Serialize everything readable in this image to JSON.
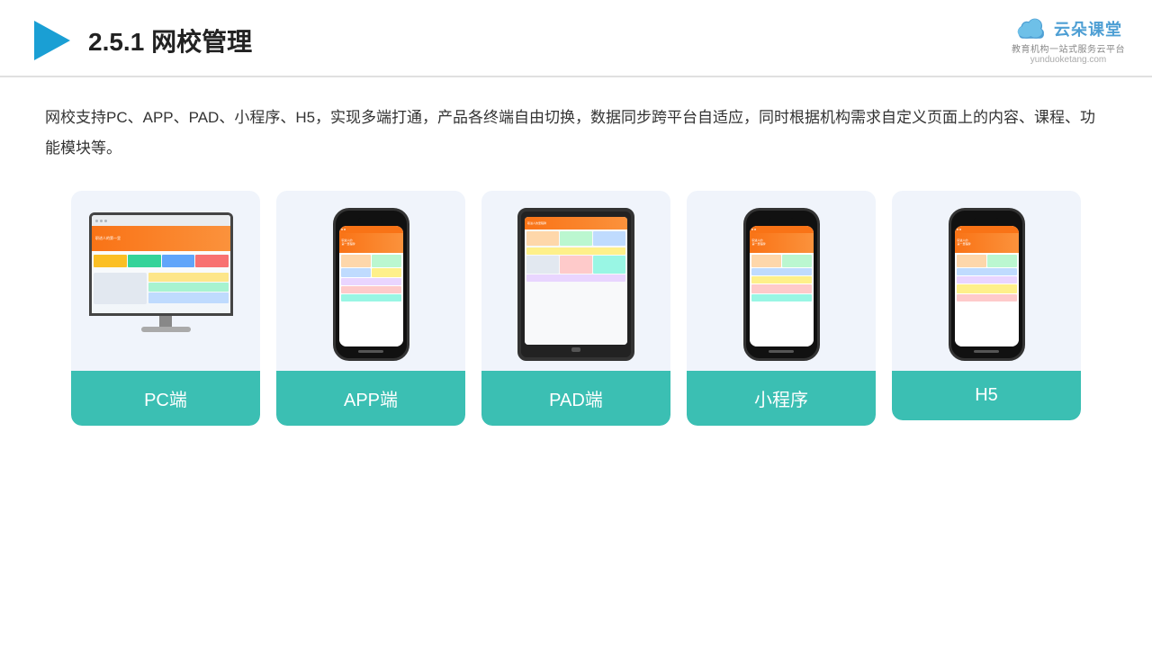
{
  "header": {
    "title": "2.5.1网校管理",
    "title_num": "2.5.1",
    "title_text": "网校管理",
    "logo_main": "云朵课堂",
    "logo_url": "yunduoketang.com",
    "logo_sub": "教育机构一站\n式服务云平台"
  },
  "description": "网校支持PC、APP、PAD、小程序、H5，实现多端打通，产品各终端自由切换，数据同步跨平台自适应，同时根据机构需求自定义页面上的内容、课程、功能模块等。",
  "cards": [
    {
      "id": "pc",
      "label": "PC端"
    },
    {
      "id": "app",
      "label": "APP端"
    },
    {
      "id": "pad",
      "label": "PAD端"
    },
    {
      "id": "miniprogram",
      "label": "小程序"
    },
    {
      "id": "h5",
      "label": "H5"
    }
  ],
  "colors": {
    "card_bg": "#eef2fa",
    "card_label_bg": "#3bbfb3",
    "accent_orange": "#f97316",
    "header_border": "#e0e0e0"
  }
}
